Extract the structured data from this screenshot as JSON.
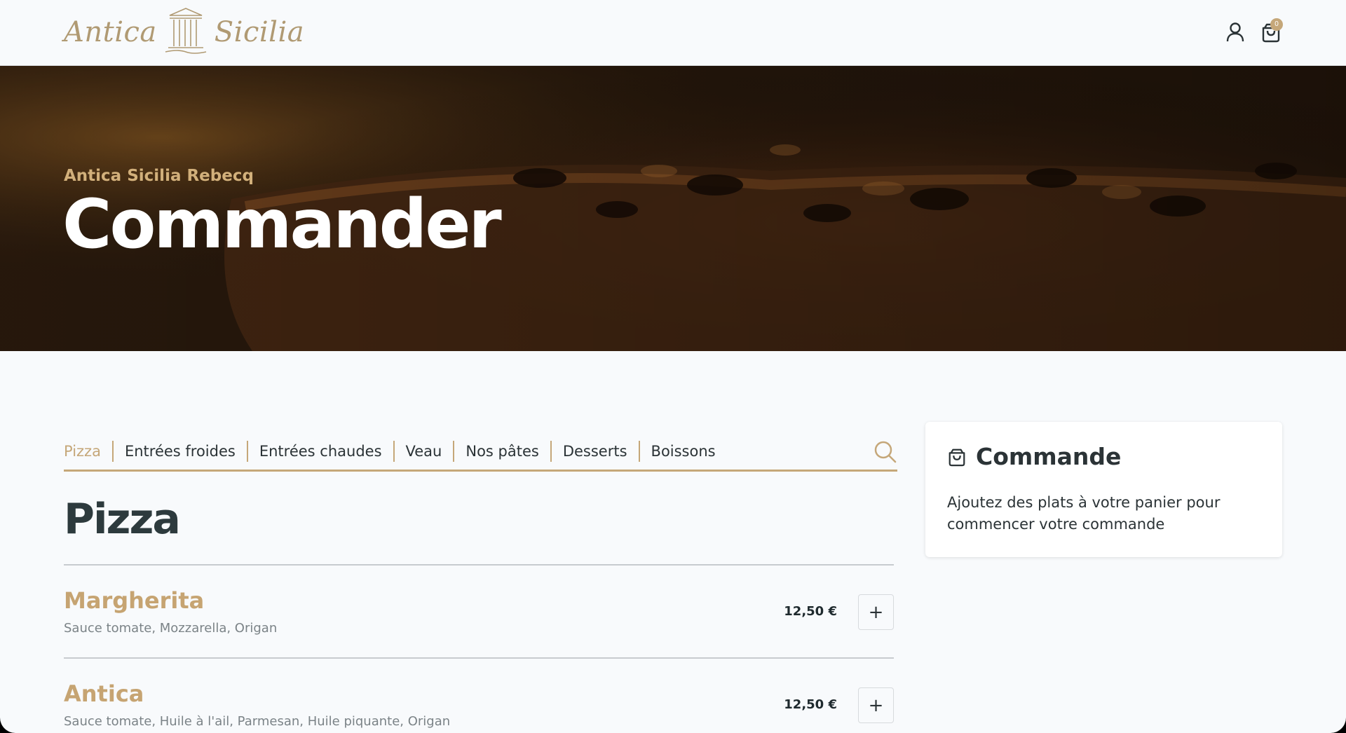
{
  "brand": {
    "name_left": "Antica",
    "name_right": "Sicilia",
    "color": "#b09a73"
  },
  "header": {
    "account_icon": "user-icon",
    "cart_icon": "shopping-bag-icon",
    "cart_count": "0"
  },
  "hero": {
    "subtitle": "Antica Sicilia Rebecq",
    "title": "Commander"
  },
  "menu": {
    "tabs": [
      {
        "label": "Pizza",
        "active": true
      },
      {
        "label": "Entrées froides",
        "active": false
      },
      {
        "label": "Entrées chaudes",
        "active": false
      },
      {
        "label": "Veau",
        "active": false
      },
      {
        "label": "Nos pâtes",
        "active": false
      },
      {
        "label": "Desserts",
        "active": false
      },
      {
        "label": "Boissons",
        "active": false
      }
    ],
    "search_icon": "search-icon",
    "accent_color": "#c5a779"
  },
  "section": {
    "title": "Pizza",
    "items": [
      {
        "name": "Margherita",
        "description": "Sauce tomate, Mozzarella, Origan",
        "price": "12,50 €",
        "add_label": "+"
      },
      {
        "name": "Antica",
        "description": "Sauce tomate, Huile à l'ail, Parmesan, Huile piquante, Origan",
        "price": "12,50 €",
        "add_label": "+"
      }
    ]
  },
  "order": {
    "icon": "shopping-bag-icon",
    "title": "Commande",
    "empty_text": "Ajoutez des plats à votre panier pour commencer votre commande"
  }
}
